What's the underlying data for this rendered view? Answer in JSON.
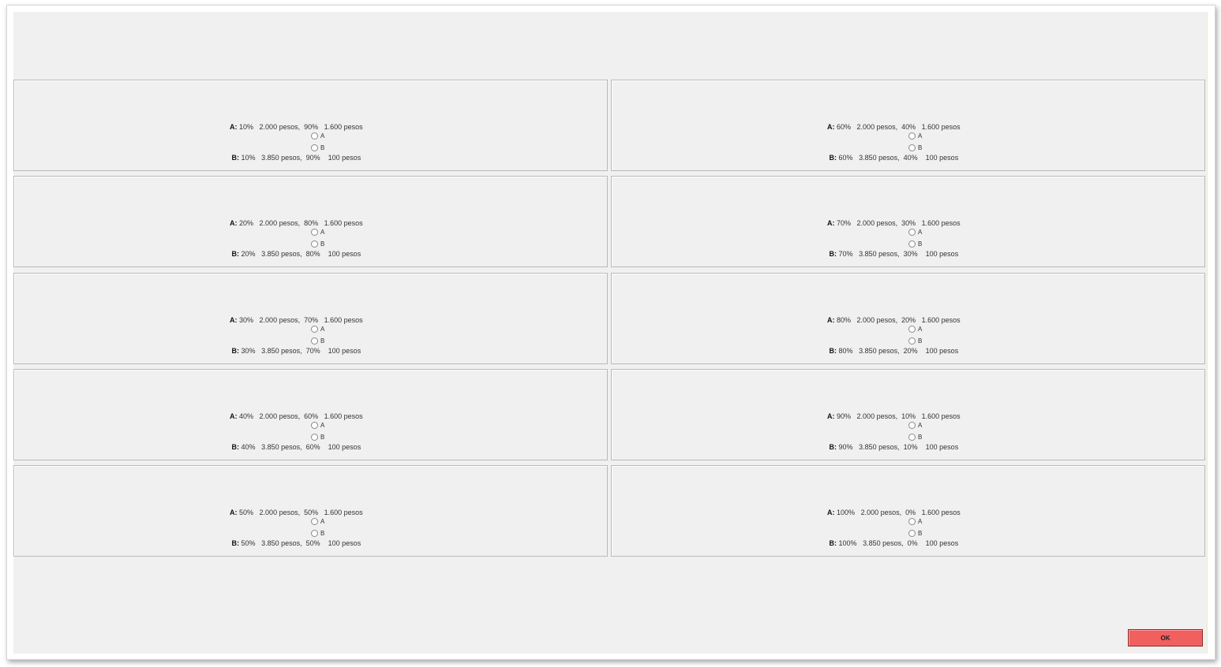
{
  "colors": {
    "background": "#f0f0f0",
    "panel_border": "#b9b9b9",
    "ok_button": "#f25f5f"
  },
  "icons": {
    "radio": "radio-button-icon"
  },
  "questions": [
    {
      "a_prob1": "10%",
      "a_pay1": "2.000 pesos,",
      "a_prob2": "90%",
      "a_pay2": "1.600 pesos",
      "b_prob1": "10%",
      "b_pay1": "3.850 pesos,",
      "b_prob2": "90%",
      "b_pay2": "100 pesos",
      "label_a": "A:",
      "label_b": "B:",
      "option_a": "A",
      "option_b": "B"
    },
    {
      "a_prob1": "20%",
      "a_pay1": "2.000 pesos,",
      "a_prob2": "80%",
      "a_pay2": "1.600 pesos",
      "b_prob1": "20%",
      "b_pay1": "3.850 pesos,",
      "b_prob2": "80%",
      "b_pay2": "100 pesos",
      "label_a": "A:",
      "label_b": "B:",
      "option_a": "A",
      "option_b": "B"
    },
    {
      "a_prob1": "30%",
      "a_pay1": "2.000 pesos,",
      "a_prob2": "70%",
      "a_pay2": "1.600 pesos",
      "b_prob1": "30%",
      "b_pay1": "3.850 pesos,",
      "b_prob2": "70%",
      "b_pay2": "100 pesos",
      "label_a": "A:",
      "label_b": "B:",
      "option_a": "A",
      "option_b": "B"
    },
    {
      "a_prob1": "40%",
      "a_pay1": "2.000 pesos,",
      "a_prob2": "60%",
      "a_pay2": "1.600 pesos",
      "b_prob1": "40%",
      "b_pay1": "3.850 pesos,",
      "b_prob2": "60%",
      "b_pay2": "100 pesos",
      "label_a": "A:",
      "label_b": "B:",
      "option_a": "A",
      "option_b": "B"
    },
    {
      "a_prob1": "50%",
      "a_pay1": "2.000 pesos,",
      "a_prob2": "50%",
      "a_pay2": "1.600 pesos",
      "b_prob1": "50%",
      "b_pay1": "3.850 pesos,",
      "b_prob2": "50%",
      "b_pay2": "100 pesos",
      "label_a": "A:",
      "label_b": "B:",
      "option_a": "A",
      "option_b": "B"
    },
    {
      "a_prob1": "60%",
      "a_pay1": "2.000 pesos,",
      "a_prob2": "40%",
      "a_pay2": "1.600 pesos",
      "b_prob1": "60%",
      "b_pay1": "3.850 pesos,",
      "b_prob2": "40%",
      "b_pay2": "100 pesos",
      "label_a": "A:",
      "label_b": "B:",
      "option_a": "A",
      "option_b": "B"
    },
    {
      "a_prob1": "70%",
      "a_pay1": "2.000 pesos,",
      "a_prob2": "30%",
      "a_pay2": "1.600 pesos",
      "b_prob1": "70%",
      "b_pay1": "3.850 pesos,",
      "b_prob2": "30%",
      "b_pay2": "100 pesos",
      "label_a": "A:",
      "label_b": "B:",
      "option_a": "A",
      "option_b": "B"
    },
    {
      "a_prob1": "80%",
      "a_pay1": "2.000 pesos,",
      "a_prob2": "20%",
      "a_pay2": "1.600 pesos",
      "b_prob1": "80%",
      "b_pay1": "3.850 pesos,",
      "b_prob2": "20%",
      "b_pay2": "100 pesos",
      "label_a": "A:",
      "label_b": "B:",
      "option_a": "A",
      "option_b": "B"
    },
    {
      "a_prob1": "90%",
      "a_pay1": "2.000 pesos,",
      "a_prob2": "10%",
      "a_pay2": "1.600 pesos",
      "b_prob1": "90%",
      "b_pay1": "3.850 pesos,",
      "b_prob2": "10%",
      "b_pay2": "100 pesos",
      "label_a": "A:",
      "label_b": "B:",
      "option_a": "A",
      "option_b": "B"
    },
    {
      "a_prob1": "100%",
      "a_pay1": "2.000 pesos,",
      "a_prob2": "0%",
      "a_pay2": "1.600 pesos",
      "b_prob1": "100%",
      "b_pay1": "3.850 pesos,",
      "b_prob2": "0%",
      "b_pay2": "100 pesos",
      "label_a": "A:",
      "label_b": "B:",
      "option_a": "A",
      "option_b": "B"
    }
  ],
  "ok_button": {
    "label": "OK"
  }
}
